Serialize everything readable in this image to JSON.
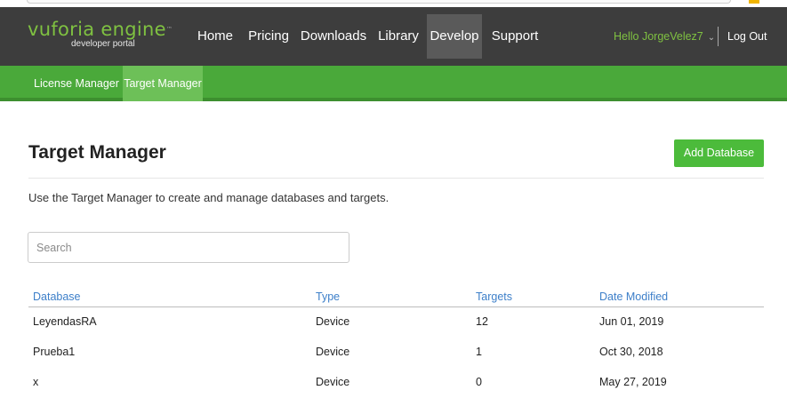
{
  "logo": {
    "main": "vuforia engine",
    "sub": "developer portal"
  },
  "nav": {
    "home": "Home",
    "pricing": "Pricing",
    "downloads": "Downloads",
    "library": "Library",
    "develop": "Develop",
    "support": "Support",
    "active": "Develop"
  },
  "user": {
    "greeting": "Hello JorgeVelez7",
    "logout": "Log Out"
  },
  "subnav": {
    "license": "License Manager",
    "target": "Target Manager",
    "active": "Target Manager"
  },
  "page": {
    "title": "Target Manager",
    "add_button": "Add Database",
    "description": "Use the Target Manager to create and manage databases and targets.",
    "search_placeholder": "Search"
  },
  "table": {
    "headers": [
      "Database",
      "Type",
      "Targets",
      "Date Modified"
    ],
    "rows": [
      [
        "LeyendasRA",
        "Device",
        "12",
        "Jun 01, 2019"
      ],
      [
        "Prueba1",
        "Device",
        "1",
        "Oct 30, 2018"
      ],
      [
        "x",
        "Device",
        "0",
        "May 27, 2019"
      ]
    ]
  },
  "colors": {
    "brand_green": "#7fc141",
    "subnav_green": "#4aa93a",
    "button_green": "#4cbb3b",
    "header_dark": "#3d3d3d",
    "link_blue": "#3d7fc9"
  }
}
